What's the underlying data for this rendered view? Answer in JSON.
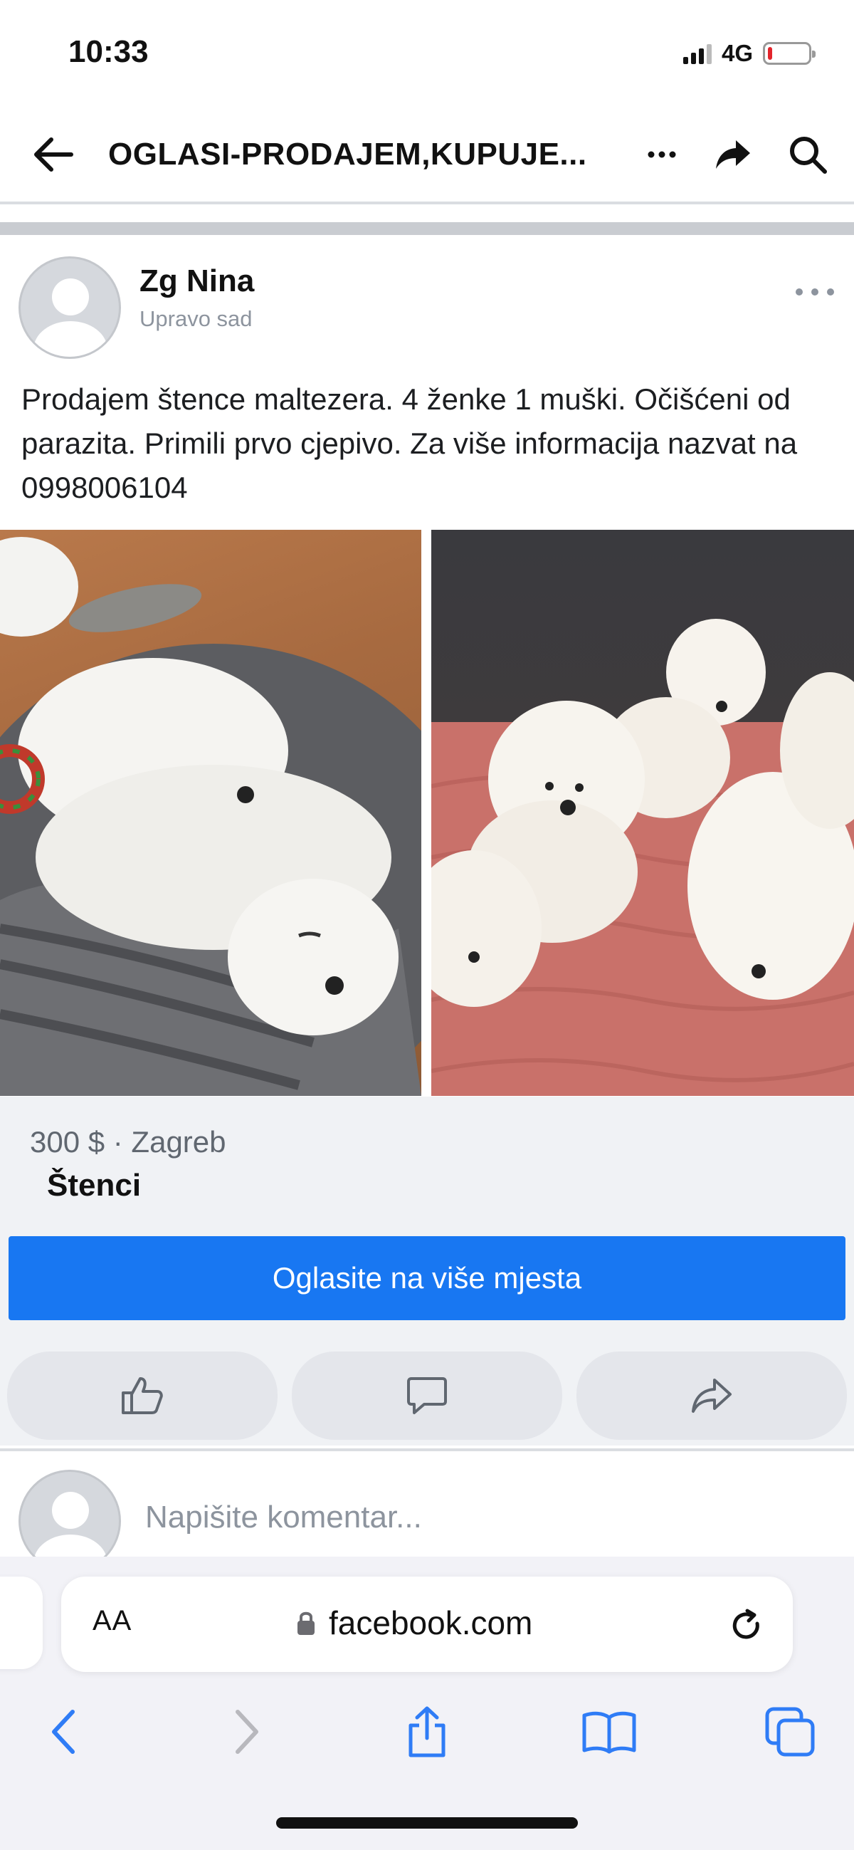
{
  "status_bar": {
    "time": "10:33",
    "network": "4G",
    "battery_level": 0.12
  },
  "header": {
    "title": "OGLASI-PRODAJEM,KUPUJE..."
  },
  "post": {
    "author": "Zg Nina",
    "time": "Upravo sad",
    "text": "Prodajem štence maltezera. 4 ženke 1 muški. Očišćeni od parazita. Primili prvo cjepivo. Za više informacija nazvat na 0998006104"
  },
  "listing": {
    "price_location": "300 $ · Zagreb",
    "item_title": "Štenci",
    "promote_label": "Oglasite na više mjesta"
  },
  "comment": {
    "placeholder": "Napišite komentar..."
  },
  "browser": {
    "aa_label": "AA",
    "url": "facebook.com"
  },
  "colors": {
    "accent": "#1877f2",
    "battery_low": "#e3242b"
  }
}
